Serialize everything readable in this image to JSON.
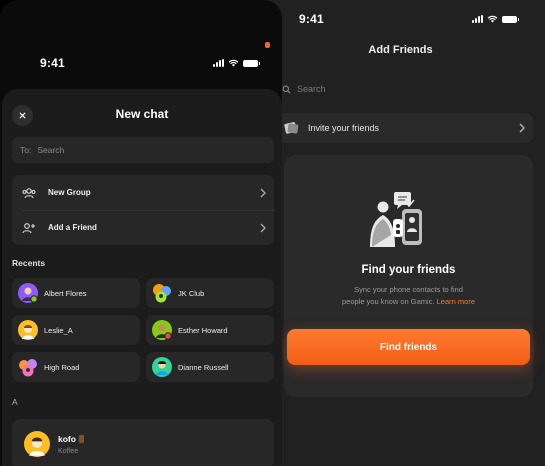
{
  "right_screen": {
    "status_time": "9:41",
    "title": "Add Friends",
    "search_placeholder": "Search",
    "invite_label": "Invite your friends",
    "find_card": {
      "title": "Find your friends",
      "subtitle_line1": "Sync your phone contacts to find",
      "subtitle_line2": "people you know on Gamic.",
      "learn_more": "Learn more",
      "button_label": "Find friends"
    }
  },
  "left_screen": {
    "status_time": "9:41",
    "title": "New chat",
    "to_label": "To:",
    "to_placeholder": "Search",
    "menu": [
      {
        "label": "New Group",
        "icon": "group-icon"
      },
      {
        "label": "Add a Friend",
        "icon": "add-friend-icon"
      }
    ],
    "recents_label": "Recents",
    "recents": [
      {
        "name": "Albert Flores",
        "avatar_color": "#8b5cf6"
      },
      {
        "name": "JK Club",
        "avatar_color": "#f59e0b"
      },
      {
        "name": "Leslie_A",
        "avatar_color": "#fbbf24"
      },
      {
        "name": "Esther Howard",
        "avatar_color": "#84cc16"
      },
      {
        "name": "High Road",
        "avatar_color": "#fb923c"
      },
      {
        "name": "Dianne Russell",
        "avatar_color": "#34d399"
      }
    ],
    "section_a": "A",
    "contact": {
      "name": "kofo",
      "subtitle": "Koffee"
    }
  },
  "colors": {
    "accent": "#f26a1f",
    "sheet": "#1c1c1c",
    "card": "#272727"
  }
}
